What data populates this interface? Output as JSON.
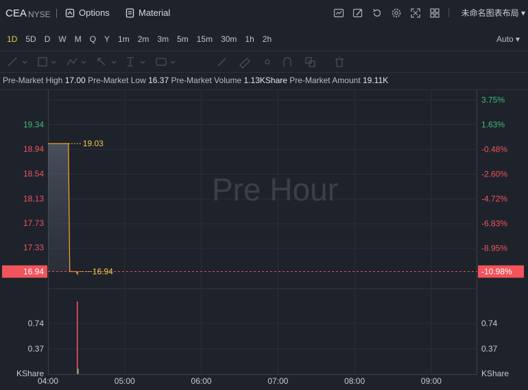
{
  "header": {
    "symbol": "CEA",
    "exchange": "NYSE",
    "options_label": "Options",
    "material_label": "Material",
    "layout_label": "未命名图表布局",
    "icons": [
      "indicator-icon",
      "draw-icon",
      "replay-icon",
      "settings-icon",
      "fullscreen-icon",
      "grid-layout-icon"
    ]
  },
  "periods": {
    "items": [
      "1D",
      "5D",
      "D",
      "W",
      "M",
      "Q",
      "Y",
      "1m",
      "2m",
      "3m",
      "5m",
      "15m",
      "30m",
      "1h",
      "2h"
    ],
    "active": "1D",
    "scale_mode": "Auto"
  },
  "info": {
    "high_label": "Pre-Market High",
    "high_value": "17.00",
    "low_label": "Pre-Market Low",
    "low_value": "16.37",
    "volume_label": "Pre-Market Volume",
    "volume_value": "1.13KShare",
    "amount_label": "Pre-Market Amount",
    "amount_value": "19.11K"
  },
  "colors": {
    "up": "#3dbd7d",
    "down": "#f2545b",
    "line": "#f0a030",
    "accent": "#f2c94c",
    "background": "#1e222b"
  },
  "chart_data": {
    "type": "line",
    "watermark": "Pre Hour",
    "price_axis": {
      "ylim": [
        16.94,
        19.74
      ],
      "ticks": [
        19.34,
        18.94,
        18.54,
        18.13,
        17.73,
        17.33
      ],
      "tick_labels": [
        "19.34",
        "18.94",
        "18.54",
        "18.13",
        "17.73",
        "17.33"
      ]
    },
    "percent_axis": {
      "ticks": [
        3.75,
        1.63,
        -0.48,
        -2.6,
        -4.72,
        -6.83,
        -8.95
      ],
      "tick_labels": [
        "3.75%",
        "1.63%",
        "-0.48%",
        "-2.60%",
        "-4.72%",
        "-6.83%",
        "-8.95%"
      ]
    },
    "x_axis": {
      "range_minutes": [
        240,
        576
      ],
      "ticks": [
        240,
        300,
        360,
        420,
        480,
        540
      ],
      "tick_labels": [
        "04:00",
        "05:00",
        "06:00",
        "07:00",
        "08:00",
        "09:00"
      ]
    },
    "series": [
      {
        "points": [
          [
            240,
            19.03
          ],
          [
            256,
            19.03
          ],
          [
            257,
            16.94
          ],
          [
            262,
            16.94
          ],
          [
            263,
            16.9
          ],
          [
            263.5,
            16.94
          ]
        ]
      }
    ],
    "annotations": {
      "high_price": "19.03",
      "current_price": "16.94"
    },
    "current": {
      "price": 16.94,
      "price_label": "16.94",
      "percent_label": "-10.98%"
    },
    "volume": {
      "unit_label": "KShare",
      "ylim": [
        0,
        1.0
      ],
      "ticks": [
        0.74,
        0.37
      ],
      "tick_labels": [
        "0.74",
        "0.37"
      ],
      "bars": [
        [
          262.5,
          0.92,
          "down"
        ],
        [
          263.2,
          0.07,
          "up"
        ]
      ]
    }
  }
}
